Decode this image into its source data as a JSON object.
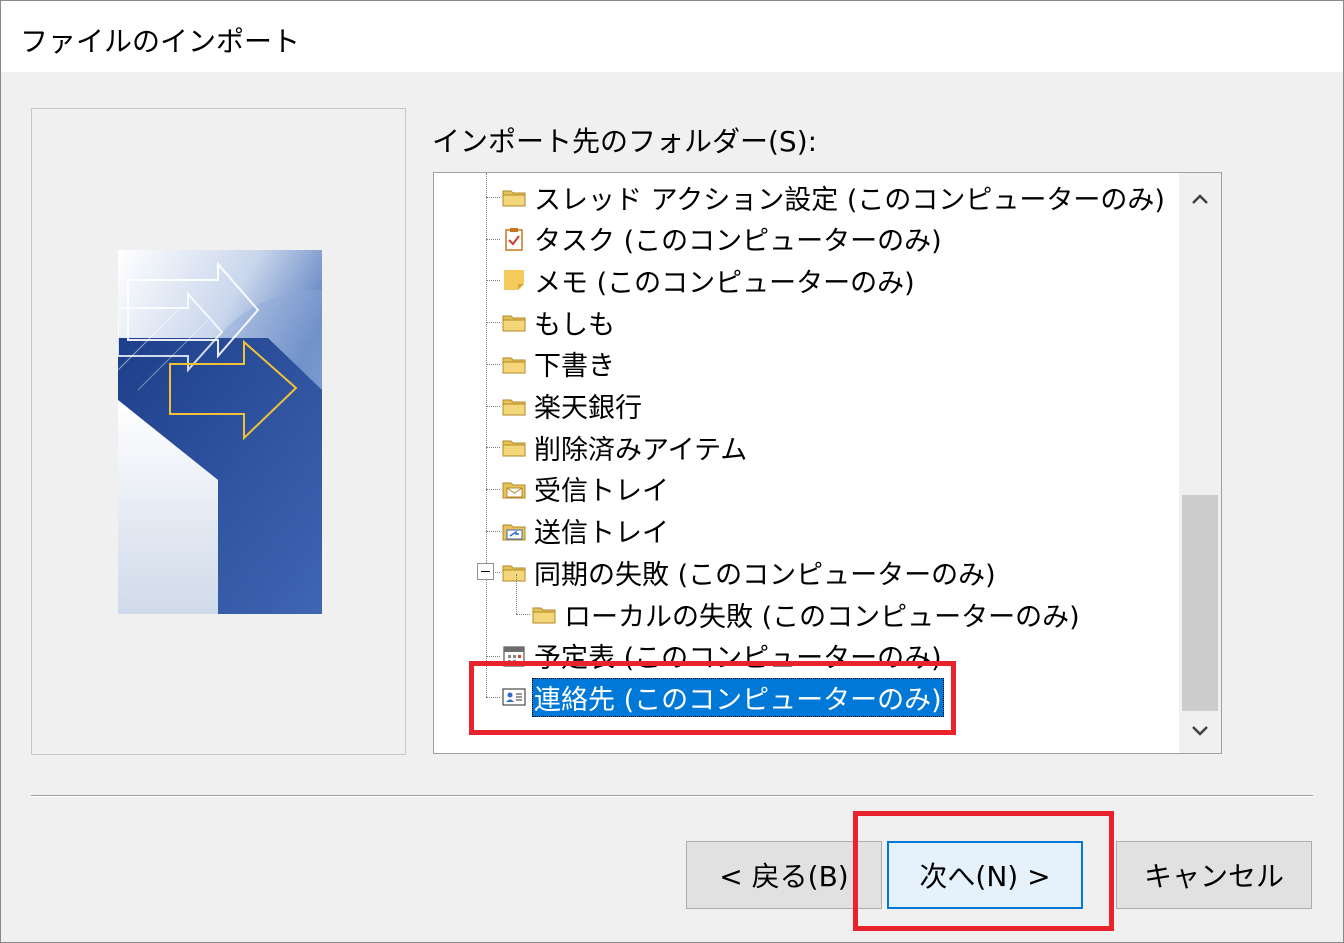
{
  "window": {
    "title": "ファイルのインポート"
  },
  "folder_label": "インポート先のフォルダー(S):",
  "tree": {
    "items": [
      {
        "label": "スレッド アクション設定 (このコンピューターのみ)",
        "icon": "folder-icon"
      },
      {
        "label": "タスク (このコンピューターのみ)",
        "icon": "task-icon"
      },
      {
        "label": "メモ (このコンピューターのみ)",
        "icon": "note-icon"
      },
      {
        "label": "もしも",
        "icon": "folder-icon"
      },
      {
        "label": "下書き",
        "icon": "folder-icon"
      },
      {
        "label": "楽天銀行",
        "icon": "folder-icon"
      },
      {
        "label": "削除済みアイテム",
        "icon": "folder-icon"
      },
      {
        "label": "受信トレイ",
        "icon": "inbox-folder-icon"
      },
      {
        "label": "送信トレイ",
        "icon": "outbox-folder-icon"
      },
      {
        "label": "同期の失敗 (このコンピューターのみ)",
        "icon": "folder-icon",
        "expanded": true
      },
      {
        "label": "ローカルの失敗 (このコンピューターのみ)",
        "icon": "folder-icon",
        "child": true
      },
      {
        "label": "予定表 (このコンピューターのみ)",
        "icon": "calendar-icon"
      },
      {
        "label": "連絡先 (このコンピューターのみ)",
        "icon": "contacts-icon",
        "selected": true
      }
    ]
  },
  "buttons": {
    "back": "< 戻る(B)",
    "next": "次へ(N) >",
    "cancel": "キャンセル"
  },
  "colors": {
    "selection": "#0078d7",
    "annotation_red": "#e8232b",
    "dialog_bg": "#f0f0f0"
  }
}
